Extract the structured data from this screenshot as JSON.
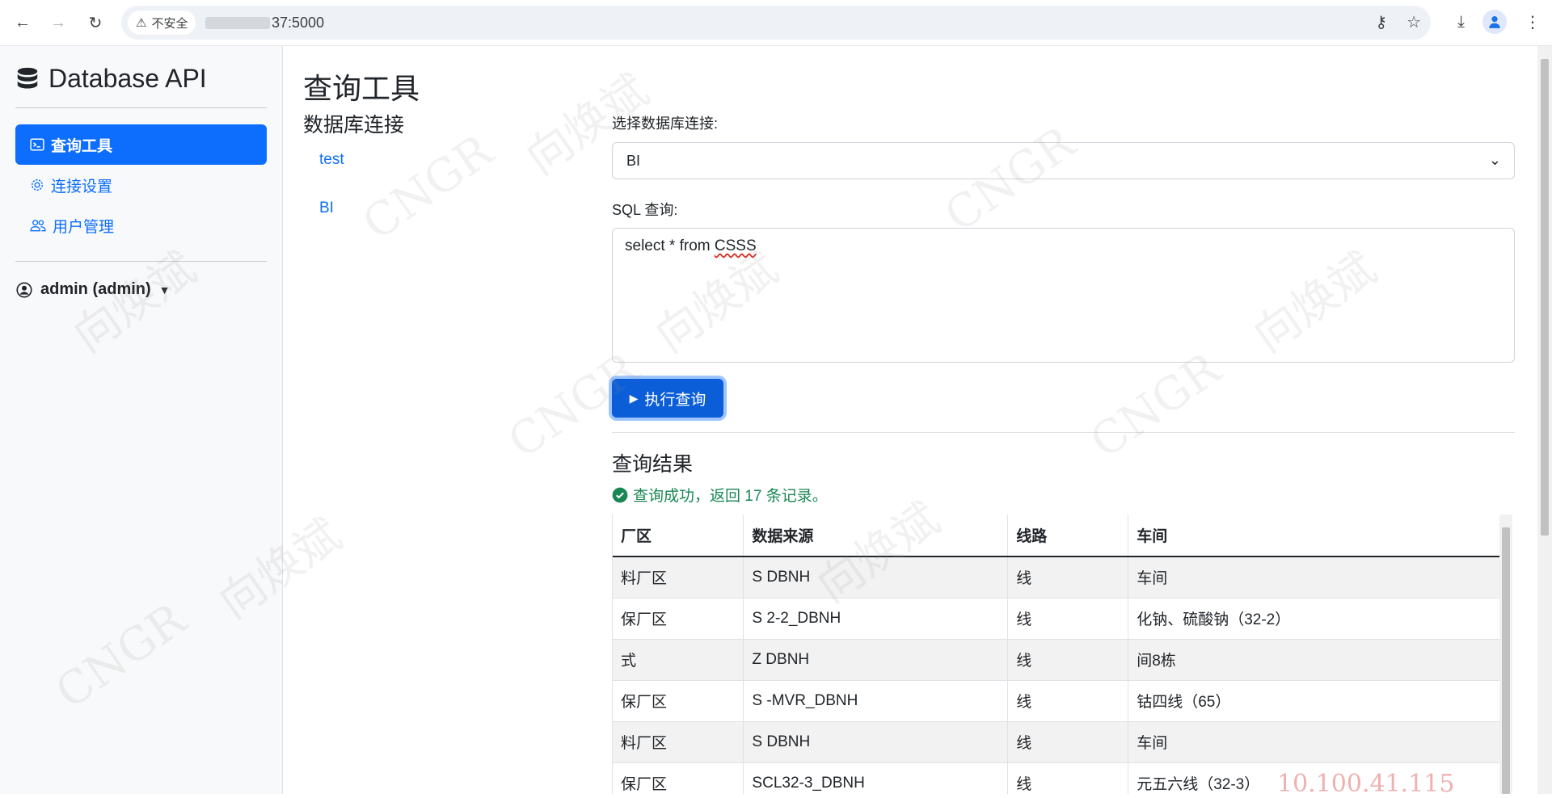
{
  "browser": {
    "insecure_label": "不安全",
    "url_suffix": "37:5000"
  },
  "sidebar": {
    "brand": "Database API",
    "items": [
      {
        "label": "查询工具",
        "icon": "terminal-icon",
        "active": true
      },
      {
        "label": "连接设置",
        "icon": "gear-icon",
        "active": false
      },
      {
        "label": "用户管理",
        "icon": "people-icon",
        "active": false
      }
    ],
    "user": "admin (admin)"
  },
  "main": {
    "title": "查询工具",
    "connections_heading": "数据库连接",
    "connections": [
      "test",
      "BI"
    ],
    "select_label": "选择数据库连接:",
    "select_value": "BI",
    "sql_label": "SQL 查询:",
    "sql_text_prefix": "select * from ",
    "sql_text_table": "CSSS",
    "run_button": "执行查询",
    "result_title": "查询结果",
    "success_message": "查询成功，返回 17 条记录。"
  },
  "table": {
    "headers": [
      "厂区",
      "数据来源",
      "线路",
      "车间"
    ],
    "rows": [
      [
        "料厂区",
        "S DBNH",
        "线",
        "车间"
      ],
      [
        "保厂区",
        "S 2-2_DBNH",
        "线",
        "化钠、硫酸钠（32-2）"
      ],
      [
        "式",
        "Z DBNH",
        "线",
        "间8栋"
      ],
      [
        "保厂区",
        "S -MVR_DBNH",
        "线",
        "钴四线（65）"
      ],
      [
        "料厂区",
        "S DBNH",
        "线",
        "车间"
      ],
      [
        "保厂区",
        "SCL32-3_DBNH",
        "线",
        "元五六线（32-3）"
      ]
    ]
  },
  "watermarks": {
    "name": "向焕斌",
    "org": "CNGR",
    "ip": "10.100.41.115"
  }
}
